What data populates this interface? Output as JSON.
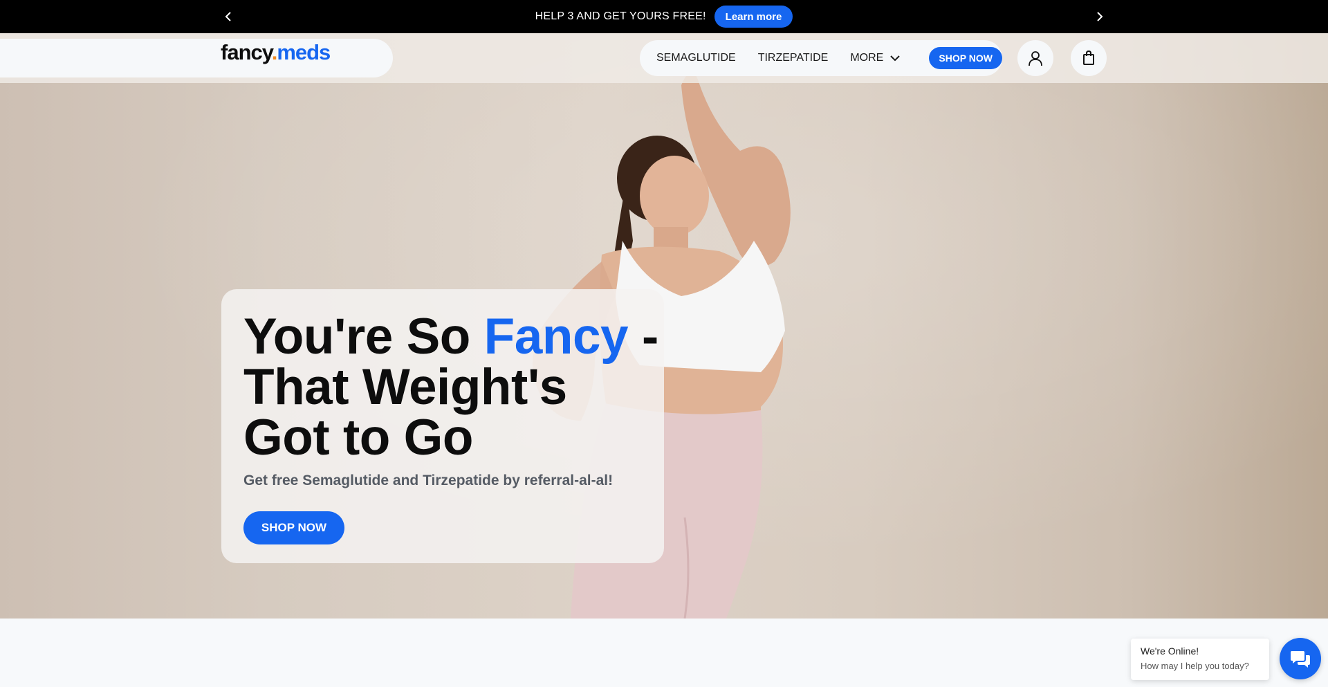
{
  "announcement": {
    "message": "HELP 3 AND GET YOURS FREE!",
    "button_label": "Learn more",
    "prev_icon": "chevron-left-icon",
    "next_icon": "chevron-right-icon"
  },
  "header": {
    "logo": {
      "part1": "fancy",
      "dot": ".",
      "part2": "meds"
    },
    "nav": {
      "items": [
        "SEMAGLUTIDE",
        "TIRZEPATIDE",
        "MORE"
      ],
      "more_icon": "chevron-down-icon",
      "shop_label": "SHOP NOW"
    },
    "account_icon": "user-icon",
    "cart_icon": "shopping-bag-icon"
  },
  "hero": {
    "title_part1": "You're So ",
    "title_accent": "Fancy",
    "title_part2": " - That Weight's Got to Go",
    "subtitle": "Get free Semaglutide and Tirzepatide by referral-al-al!",
    "cta_label": "SHOP NOW"
  },
  "chat": {
    "status": "We're Online!",
    "prompt": "How may I help you today?",
    "icon": "chat-icon"
  },
  "colors": {
    "accent": "#1666f0",
    "logo_dot": "#f08a24",
    "announcement_bg": "#000000"
  }
}
